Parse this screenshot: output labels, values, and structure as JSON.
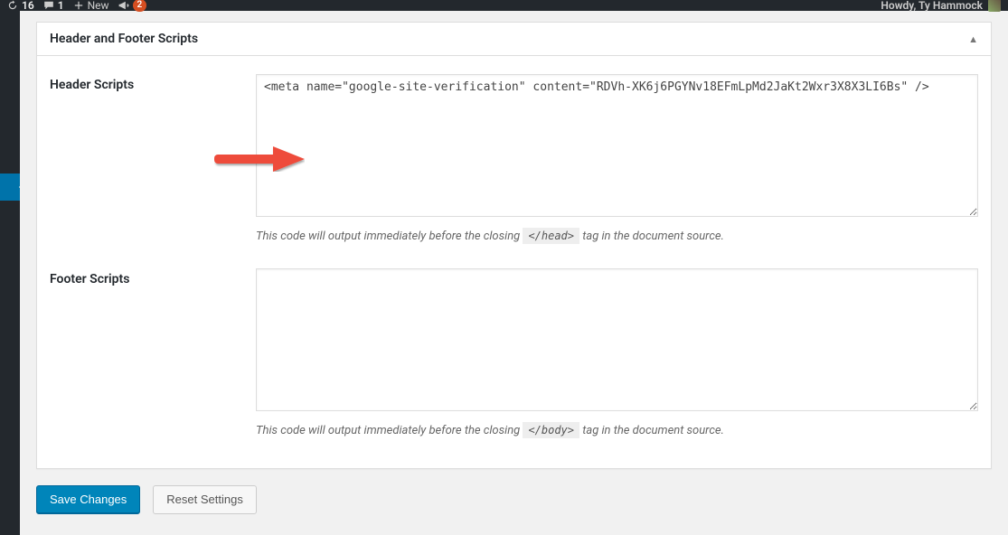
{
  "topbar": {
    "updates_count": "16",
    "comments_count": "1",
    "new_label": "New",
    "notif_count": "2",
    "greeting": "Howdy, Ty Hammock"
  },
  "panel": {
    "title": "Header and Footer Scripts"
  },
  "header_scripts": {
    "label": "Header Scripts",
    "value": "<meta name=\"google-site-verification\" content=\"RDVh-XK6j6PGYNv18EFmLpMd2JaKt2Wxr3X8X3LI6Bs\" />",
    "desc_before": "This code will output immediately before the closing ",
    "tag": "</head>",
    "desc_after": " tag in the document source."
  },
  "footer_scripts": {
    "label": "Footer Scripts",
    "value": "",
    "desc_before": "This code will output immediately before the closing ",
    "tag": "</body>",
    "desc_after": " tag in the document source."
  },
  "buttons": {
    "save": "Save Changes",
    "reset": "Reset Settings"
  }
}
